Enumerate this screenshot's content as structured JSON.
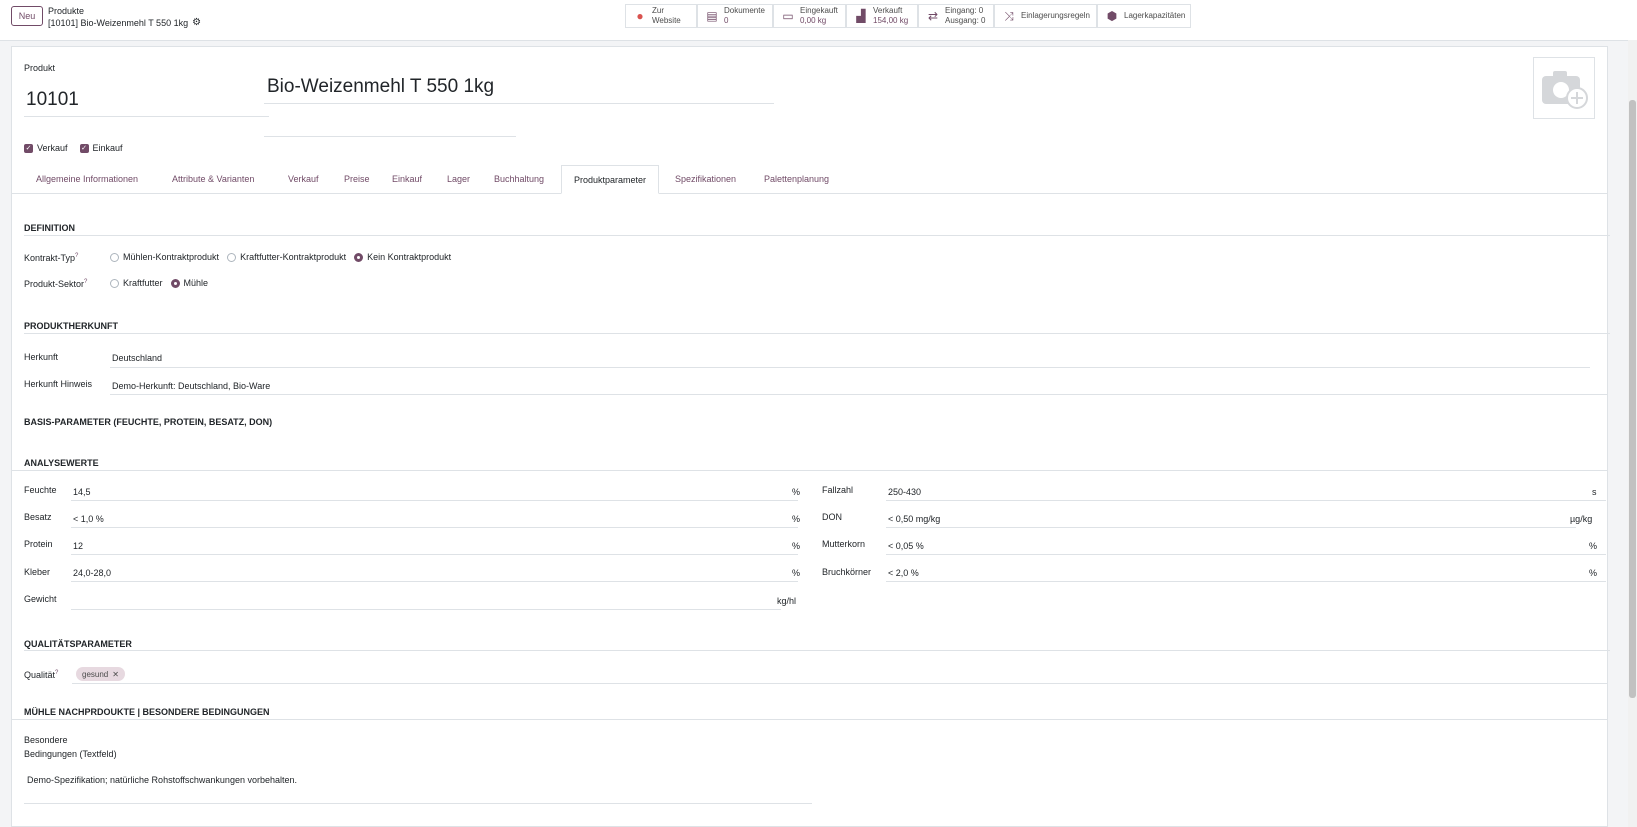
{
  "header": {
    "new_button": "Neu",
    "breadcrumb_parent": "Produkte",
    "breadcrumb_current": "[10101] Bio-Weizenmehl T 550 1kg"
  },
  "smart_buttons": {
    "website": {
      "line1": "Zur",
      "line2": "Website"
    },
    "documents": {
      "title": "Dokumente",
      "value": "0"
    },
    "purchased": {
      "title": "Eingekauft",
      "value": "0,00 kg"
    },
    "sold": {
      "title": "Verkauft",
      "value": "154,00 kg"
    },
    "moves": {
      "line1": "Eingang: 0",
      "line2": "Ausgang: 0"
    },
    "putaway": {
      "title": "Einlagerungsregeln"
    },
    "capacity": {
      "title": "Lagerkapazitäten"
    }
  },
  "product": {
    "label": "Produkt",
    "code": "10101",
    "name": "Bio-Weizenmehl T 550 1kg",
    "sale_ok_label": "Verkauf",
    "purchase_ok_label": "Einkauf"
  },
  "tabs": [
    {
      "label": "Allgemeine Informationen"
    },
    {
      "label": "Attribute & Varianten"
    },
    {
      "label": "Verkauf"
    },
    {
      "label": "Preise"
    },
    {
      "label": "Einkauf"
    },
    {
      "label": "Lager"
    },
    {
      "label": "Buchhaltung"
    },
    {
      "label": "Produktparameter"
    },
    {
      "label": "Spezifikationen"
    },
    {
      "label": "Palettenplanung"
    }
  ],
  "definition": {
    "title": "DEFINITION",
    "contract_type_label": "Kontrakt-Typ",
    "contract_options": [
      "Mühlen-Kontraktprodukt",
      "Kraftfutter-Kontraktprodukt",
      "Kein Kontraktprodukt"
    ],
    "contract_selected": "Kein Kontraktprodukt",
    "sector_label": "Produkt-Sektor",
    "sector_options": [
      "Kraftfutter",
      "Mühle"
    ],
    "sector_selected": "Mühle"
  },
  "origin": {
    "title": "PRODUKTHERKUNFT",
    "origin_label": "Herkunft",
    "origin_value": "Deutschland",
    "hint_label": "Herkunft Hinweis",
    "hint_value": "Demo-Herkunft: Deutschland, Bio-Ware"
  },
  "basis_title": "BASIS-PARAMETER (FEUCHTE, PROTEIN, BESATZ, DON)",
  "analysis": {
    "title": "ANALYSEWERTE",
    "left": [
      {
        "label": "Feuchte",
        "value": "14,5",
        "unit": "%"
      },
      {
        "label": "Besatz",
        "value": "< 1,0 %",
        "unit": "%"
      },
      {
        "label": "Protein",
        "value": "12",
        "unit": "%"
      },
      {
        "label": "Kleber",
        "value": "24,0-28,0",
        "unit": "%"
      },
      {
        "label": "Gewicht",
        "value": "",
        "unit": "kg/hl"
      }
    ],
    "right": [
      {
        "label": "Fallzahl",
        "value": "250-430",
        "unit": "s"
      },
      {
        "label": "DON",
        "value": "< 0,50 mg/kg",
        "unit": "µg/kg"
      },
      {
        "label": "Mutterkorn",
        "value": "< 0,05 %",
        "unit": "%"
      },
      {
        "label": "Bruchkörner",
        "value": "< 2,0 %",
        "unit": "%"
      }
    ]
  },
  "quality": {
    "title": "QUALITÄTSPARAMETER",
    "label": "Qualität",
    "tag": "gesund"
  },
  "conditions": {
    "title": "MÜHLE NACHPRDOUKTE | BESONDERE BEDINGUNGEN",
    "label_line1": "Besondere",
    "label_line2": "Bedingungen (Textfeld)",
    "value": "Demo-Spezifikation; natürliche Rohstoffschwankungen vorbehalten."
  },
  "colors": {
    "accent": "#714B67",
    "tag_bg": "#e7d9e0"
  }
}
